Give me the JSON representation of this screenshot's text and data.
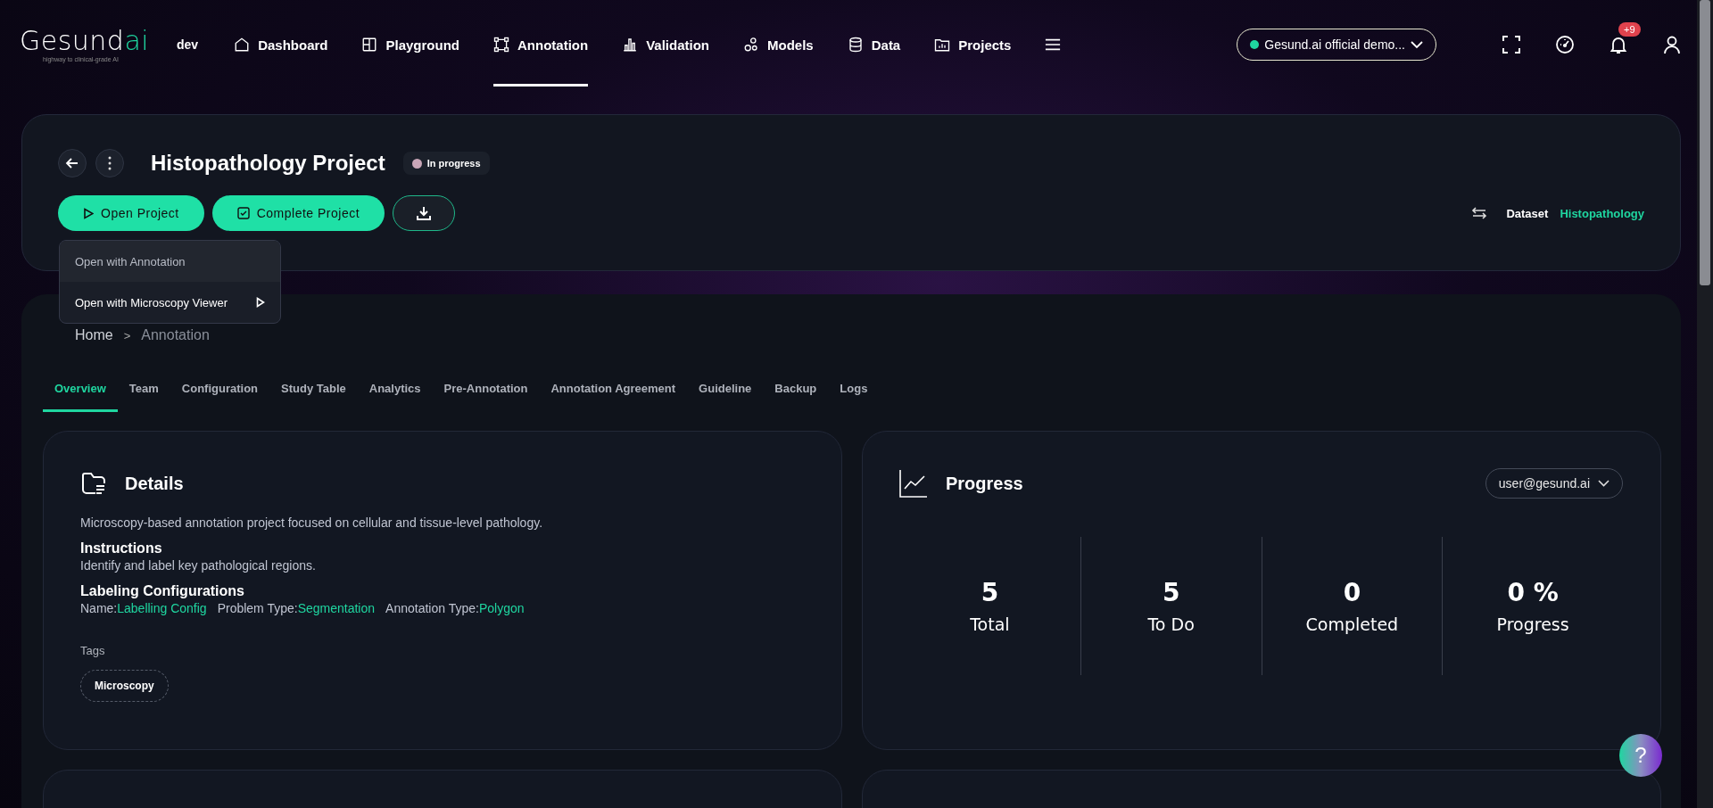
{
  "logo": {
    "text": "Gesund",
    "accent": "ai",
    "tagline": "highway to clinical-grade AI"
  },
  "environment": "dev",
  "nav": [
    {
      "label": "Dashboard",
      "selected": false
    },
    {
      "label": "Playground",
      "selected": false
    },
    {
      "label": "Annotation",
      "selected": true
    },
    {
      "label": "Validation",
      "selected": false
    },
    {
      "label": "Models",
      "selected": false
    },
    {
      "label": "Data",
      "selected": false
    },
    {
      "label": "Projects",
      "selected": false
    }
  ],
  "workspace": {
    "label": "Gesund.ai official demo...",
    "color": "#1fd6a0"
  },
  "notifications": {
    "badge": "+9"
  },
  "project": {
    "title": "Histopathology Project",
    "status": {
      "label": "In progress",
      "color": "#c9a6b8"
    },
    "actions": [
      "Open Project",
      "Complete Project"
    ],
    "dataset": {
      "label": "Dataset",
      "value": "Histopathology"
    }
  },
  "open_menu": {
    "items": [
      {
        "label": "Open with Annotation",
        "highlighted": true,
        "submenu": false
      },
      {
        "label": "Open with Microscopy Viewer",
        "highlighted": false,
        "submenu": true
      }
    ]
  },
  "breadcrumb": [
    "Home",
    "Annotation"
  ],
  "breadcrumb_separator": ">",
  "tabs": [
    {
      "label": "Overview",
      "selected": true
    },
    {
      "label": "Team",
      "selected": false
    },
    {
      "label": "Configuration",
      "selected": false
    },
    {
      "label": "Study Table",
      "selected": false
    },
    {
      "label": "Analytics",
      "selected": false
    },
    {
      "label": "Pre-Annotation",
      "selected": false
    },
    {
      "label": "Annotation Agreement",
      "selected": false
    },
    {
      "label": "Guideline",
      "selected": false
    },
    {
      "label": "Backup",
      "selected": false
    },
    {
      "label": "Logs",
      "selected": false
    }
  ],
  "details": {
    "title": "Details",
    "description": "Microscopy-based annotation project focused on cellular and tissue-level pathology.",
    "instructions": {
      "heading": "Instructions",
      "text": "Identify and label key pathological regions."
    },
    "configurations": {
      "heading": "Labeling Configurations",
      "fields": [
        {
          "label": "Name:",
          "value": "Labelling Config"
        },
        {
          "label": "Problem Type:",
          "value": "Segmentation"
        },
        {
          "label": "Annotation Type:",
          "value": "Polygon"
        }
      ]
    },
    "tags": {
      "label": "Tags",
      "items": [
        "Microscopy"
      ]
    }
  },
  "progress": {
    "title": "Progress",
    "user": "user@gesund.ai",
    "stats": [
      {
        "value": "5",
        "label": "Total"
      },
      {
        "value": "5",
        "label": "To Do"
      },
      {
        "value": "0",
        "label": "Completed"
      },
      {
        "value": "0 %",
        "label": "Progress"
      }
    ]
  },
  "help": {
    "label": "?"
  }
}
